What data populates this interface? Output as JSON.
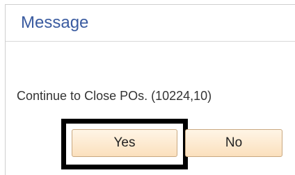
{
  "dialog": {
    "title": "Message",
    "message": "Continue to Close POs. (10224,10)",
    "buttons": {
      "yes_label": "Yes",
      "no_label": "No"
    }
  },
  "colors": {
    "title": "#3a5ba0",
    "button_bg": "#fbe0bd",
    "highlight_border": "#000000"
  }
}
